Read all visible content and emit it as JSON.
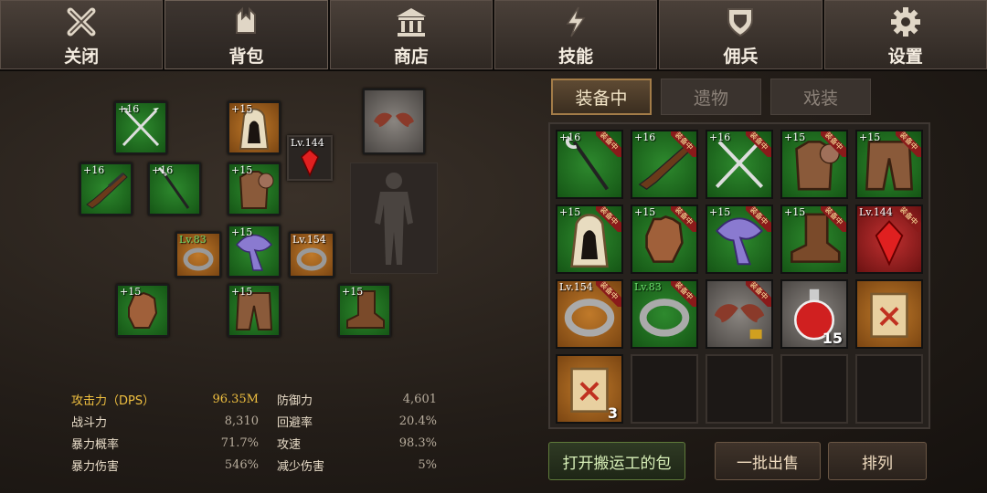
{
  "nav": [
    {
      "label": "关闭",
      "icon": "close-icon"
    },
    {
      "label": "背包",
      "icon": "backpack-icon"
    },
    {
      "label": "商店",
      "icon": "shop-icon"
    },
    {
      "label": "技能",
      "icon": "skill-lightning-icon"
    },
    {
      "label": "佣兵",
      "icon": "mercenary-shield-icon"
    },
    {
      "label": "设置",
      "icon": "gear-icon"
    }
  ],
  "equipped_slots": [
    {
      "name": "spear-icon",
      "level": "+16"
    },
    {
      "name": "hood-icon",
      "level": "+15"
    },
    {
      "name": "red-gem-icon",
      "level": "Lv.144"
    },
    {
      "name": "bat-wings-icon",
      "level": ""
    },
    {
      "name": "rifle-icon",
      "level": "+16"
    },
    {
      "name": "staff-icon",
      "level": "+16"
    },
    {
      "name": "armor-icon",
      "level": "+15"
    },
    {
      "name": "ring-icon",
      "level": "Lv.83"
    },
    {
      "name": "scarf-icon",
      "level": "+15"
    },
    {
      "name": "ring-icon",
      "level": "Lv.154"
    },
    {
      "name": "gloves-icon",
      "level": "+15"
    },
    {
      "name": "pants-icon",
      "level": "+15"
    },
    {
      "name": "boots-icon",
      "level": "+15"
    }
  ],
  "stats": {
    "attack_label": "攻击力（DPS）",
    "attack": "96.35M",
    "defense_label": "防御力",
    "defense": "4,601",
    "power_label": "战斗力",
    "power": "8,310",
    "dodge_label": "回避率",
    "dodge": "20.4%",
    "crit_rate_label": "暴力概率",
    "crit_rate": "71.7%",
    "atk_speed_label": "攻速",
    "atk_speed": "98.3%",
    "crit_dmg_label": "暴力伤害",
    "crit_dmg": "546%",
    "dmg_reduce_label": "减少伤害",
    "dmg_reduce": "5%"
  },
  "tabs": [
    "装备中",
    "遗物",
    "戏装"
  ],
  "equipped_badge": "装备中",
  "inventory": [
    {
      "icon": "staff-icon",
      "level": "+16",
      "equipped": true,
      "color": "green"
    },
    {
      "icon": "rifle-icon",
      "level": "+16",
      "equipped": true,
      "color": "green"
    },
    {
      "icon": "spear-icon",
      "level": "+16",
      "equipped": true,
      "color": "green"
    },
    {
      "icon": "armor-icon",
      "level": "+15",
      "equipped": true,
      "color": "green"
    },
    {
      "icon": "pants-icon",
      "level": "+15",
      "equipped": true,
      "color": "green"
    },
    {
      "icon": "hood-icon",
      "level": "+15",
      "equipped": true,
      "color": "green"
    },
    {
      "icon": "gloves-icon",
      "level": "+15",
      "equipped": true,
      "color": "green"
    },
    {
      "icon": "scarf-icon",
      "level": "+15",
      "equipped": true,
      "color": "green"
    },
    {
      "icon": "boots-icon",
      "level": "+15",
      "equipped": true,
      "color": "green"
    },
    {
      "icon": "red-gem-icon",
      "level": "Lv.144",
      "equipped": true,
      "color": "red"
    },
    {
      "icon": "ring-icon",
      "level": "Lv.154",
      "equipped": true,
      "color": "orange"
    },
    {
      "icon": "ring-icon",
      "level": "Lv.83",
      "equipped": true,
      "color": "green"
    },
    {
      "icon": "bat-wings-icon",
      "level": "",
      "equipped": true,
      "color": "gray"
    },
    {
      "icon": "potion-icon",
      "level": "",
      "qty": "15",
      "color": "gray"
    },
    {
      "icon": "scroll-icon",
      "level": "",
      "color": "orange"
    },
    {
      "icon": "scroll-icon",
      "level": "",
      "qty": "3",
      "color": "orange"
    }
  ],
  "buttons": {
    "open_bag": "打开搬运工的包",
    "bulk_sell": "一批出售",
    "sort": "排列"
  }
}
